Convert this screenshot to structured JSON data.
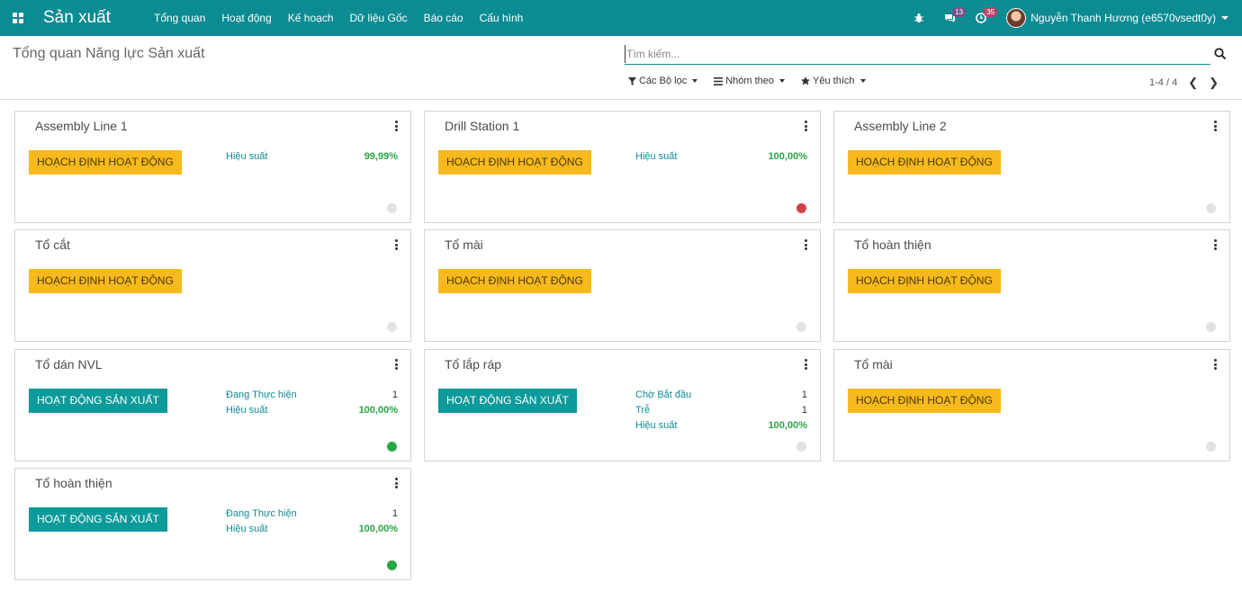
{
  "navbar": {
    "app_name": "Sản xuất",
    "menu": [
      "Tổng quan",
      "Hoạt động",
      "Kế hoạch",
      "Dữ liệu Gốc",
      "Báo cáo",
      "Cấu hình"
    ],
    "messages_count": "13",
    "activities_count": "35",
    "user_name": "Nguyễn Thanh Hương (e6570vsedt0y)"
  },
  "control_panel": {
    "title": "Tổng quan Năng lực Sản xuất",
    "search_placeholder": "Tìm kiếm...",
    "filters_label": "Các Bộ lọc",
    "group_by_label": "Nhóm theo",
    "favorites_label": "Yêu thích",
    "pager": "1-4 / 4"
  },
  "cards": [
    {
      "title": "Assembly Line 1",
      "button": "HOẠCH ĐỊNH HOẠT ĐỘNG",
      "stats": [
        {
          "label": "Hiệu suất",
          "value": "99,99%"
        }
      ],
      "status": "gray"
    },
    {
      "title": "Drill Station 1",
      "button": "HOẠCH ĐỊNH HOẠT ĐỘNG",
      "stats": [
        {
          "label": "Hiệu suất",
          "value": "100,00%"
        }
      ],
      "status": "red"
    },
    {
      "title": "Assembly Line 2",
      "button": "HOẠCH ĐỊNH HOẠT ĐỘNG",
      "stats": [],
      "status": "gray"
    },
    {
      "title": "Tổ cắt",
      "button": "HOẠCH ĐỊNH HOẠT ĐỘNG",
      "stats": [],
      "status": "gray"
    },
    {
      "title": "Tổ mài",
      "button": "HOẠCH ĐỊNH HOẠT ĐỘNG",
      "stats": [],
      "status": "gray"
    },
    {
      "title": "Tổ hoàn thiện",
      "button": "HOẠCH ĐỊNH HOẠT ĐỘNG",
      "stats": [],
      "status": "gray"
    },
    {
      "title": "Tổ dán NVL",
      "button": "HOẠT ĐỘNG SẢN XUẤT",
      "stats": [
        {
          "label": "Đang Thực hiện",
          "value": "1"
        },
        {
          "label": "Hiệu suất",
          "value": "100,00%"
        }
      ],
      "status": "green"
    },
    {
      "title": "Tổ lắp ráp",
      "button": "HOẠT ĐỘNG SẢN XUẤT",
      "stats": [
        {
          "label": "Chờ Bắt đầu",
          "value": "1"
        },
        {
          "label": "Trễ",
          "value": "1"
        },
        {
          "label": "Hiệu suất",
          "value": "100,00%"
        }
      ],
      "status": "gray"
    },
    {
      "title": "Tổ mài",
      "button": "HOẠCH ĐỊNH HOẠT ĐỘNG",
      "stats": [],
      "status": "gray"
    },
    {
      "title": "Tổ hoàn thiện",
      "button": "HOẠT ĐỘNG SẢN XUẤT",
      "stats": [
        {
          "label": "Đang Thực hiện",
          "value": "1"
        },
        {
          "label": "Hiệu suất",
          "value": "100,00%"
        }
      ],
      "status": "green"
    }
  ],
  "colors": {
    "brand": "#0c8b93",
    "plan_button": "#f7b91d",
    "production_button": "#0d9a9a",
    "status_red": "#d23f4b",
    "status_green": "#28a745"
  }
}
